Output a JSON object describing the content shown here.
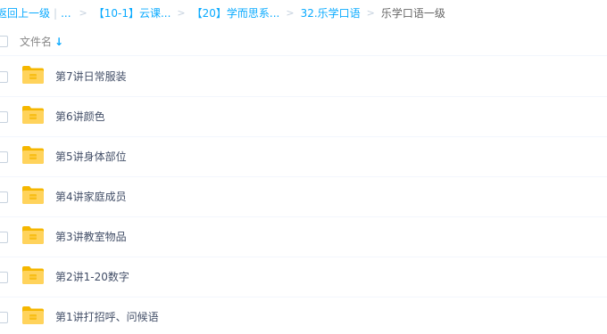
{
  "breadcrumb": {
    "back_label": "返回上一级",
    "ellipsis": "...",
    "items": [
      "【10-1】云课...",
      "【20】学而思系...",
      "32.乐学口语"
    ],
    "current": "乐学口语一级"
  },
  "header": {
    "column_label": "文件名",
    "sort_icon": "arrow-down-icon"
  },
  "files": [
    {
      "name": "第7讲日常服装",
      "icon": "folder-icon"
    },
    {
      "name": "第6讲颜色",
      "icon": "folder-icon"
    },
    {
      "name": "第5讲身体部位",
      "icon": "folder-icon"
    },
    {
      "name": "第4讲家庭成员",
      "icon": "folder-icon"
    },
    {
      "name": "第3讲教室物品",
      "icon": "folder-icon"
    },
    {
      "name": "第2讲1-20数字",
      "icon": "folder-icon"
    },
    {
      "name": "第1讲打招呼、问候语",
      "icon": "folder-icon"
    }
  ],
  "colors": {
    "link": "#09aaff",
    "text": "#424e67",
    "folder": "#ffd35c",
    "folder_dark": "#f5b700"
  }
}
